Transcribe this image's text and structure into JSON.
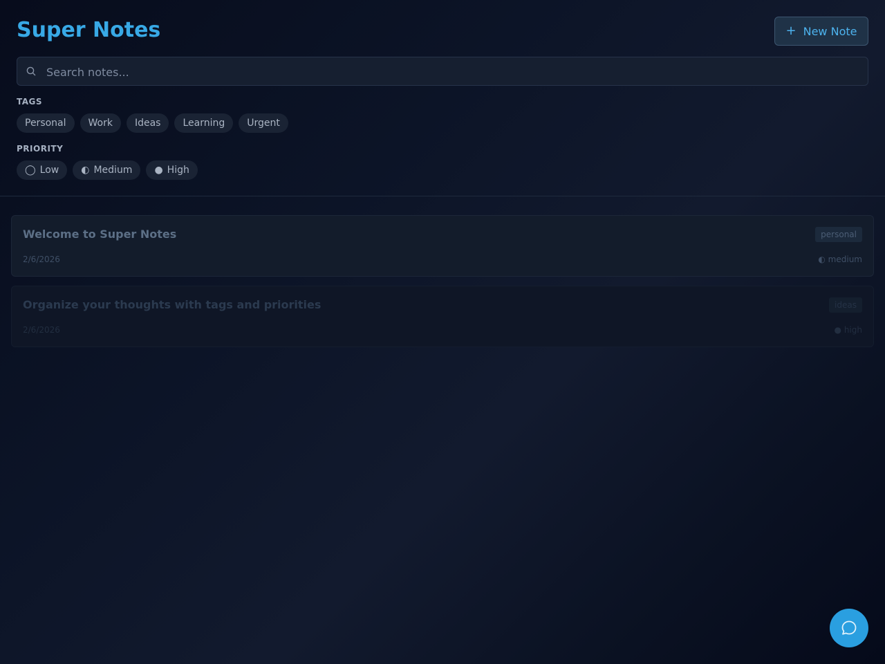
{
  "app": {
    "title": "Super Notes",
    "new_note_label": "New Note",
    "new_note_icon": "plus-icon"
  },
  "search": {
    "placeholder": "Search notes...",
    "value": "",
    "icon": "search-icon"
  },
  "filters": {
    "tags_label": "TAGS",
    "tags": [
      "Personal",
      "Work",
      "Ideas",
      "Learning",
      "Urgent"
    ],
    "priority_label": "PRIORITY",
    "priorities": [
      {
        "symbol": "◯",
        "label": "Low"
      },
      {
        "symbol": "◐",
        "label": "Medium"
      },
      {
        "symbol": "●",
        "label": "High"
      }
    ]
  },
  "notes": [
    {
      "title": "Welcome to Super Notes",
      "date": "2/6/2026",
      "tag": "personal",
      "priority_symbol": "◐",
      "priority": "medium"
    },
    {
      "title": "Organize your thoughts with tags and priorities",
      "date": "2/6/2026",
      "tag": "ideas",
      "priority_symbol": "●",
      "priority": "high"
    }
  ],
  "chat": {
    "icon": "chat-bubble-icon"
  },
  "colors": {
    "accent": "#38a9e6",
    "fab": "#2a9fe0",
    "background": "#0c1427"
  }
}
